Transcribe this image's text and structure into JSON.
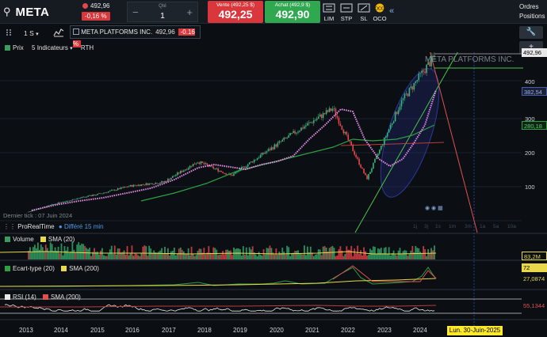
{
  "header": {
    "symbol": "META",
    "last_price": "492,96",
    "change_pct": "-0,16 %",
    "qty_label": "Qté",
    "qty_value": "1",
    "sell_label": "Vente (492,25 $)",
    "sell_price": "492,25",
    "buy_label": "Achat (492,9 $)",
    "buy_price": "492,90",
    "order_buttons": [
      "LIM",
      "STP",
      "SL",
      "OCO"
    ],
    "orders_label": "Ordres",
    "positions_label": "Positions"
  },
  "toolbar": {
    "timeframe": "1 S",
    "instrument_name": "META PLATFORMS INC.",
    "instrument_price": "492,96",
    "instrument_change": "-0.16 %"
  },
  "legend": {
    "price_label": "Prix",
    "indicators_label": "5 Indicateurs",
    "session_label": "RTH"
  },
  "chart_overlay": {
    "watermark": "META PLATFORMS INC.",
    "last_tick": "Dernier tick : 07 Juin 2024",
    "provider": "ProRealTime",
    "delay": "Différé 15 min",
    "zoom_labels": [
      "1j",
      "3j",
      "1s",
      "1m",
      "3m",
      "1a",
      "5a",
      "10a"
    ]
  },
  "price_axis": {
    "ticks": [
      "400",
      "300",
      "200",
      "100"
    ],
    "labels": {
      "last": "492,96",
      "sma_fast": "382,54",
      "sma_slow": "280,18",
      "volume": "83,2M",
      "stdev_top": "72",
      "stdev": "27,0874",
      "rsi": "55,1344"
    }
  },
  "panels": {
    "volume": {
      "name": "Volume",
      "sma": "SMA (20)"
    },
    "stdev": {
      "name": "Ecart-type (20)",
      "sma": "SMA (200)"
    },
    "rsi": {
      "name": "RSI (14)",
      "sma": "SMA (200)"
    }
  },
  "x_axis": {
    "years": [
      "2013",
      "2014",
      "2015",
      "2016",
      "2017",
      "2018",
      "2019",
      "2020",
      "2021",
      "2022",
      "2023",
      "2024"
    ],
    "cursor_date": "Lun. 30-Juin-2025"
  },
  "colors": {
    "sell": "#d9373c",
    "buy": "#2fa84f",
    "sma_fast": "#e88ce8",
    "sma_slow": "#2ea043",
    "accent_blue": "#2c5fd8"
  },
  "chart_data": {
    "type": "candlestick",
    "title": "META PLATFORMS INC.",
    "timeframe": "1 S",
    "ylim": [
      0,
      500
    ],
    "yticks": [
      100,
      200,
      300,
      400
    ],
    "x": [
      "2013",
      "2014",
      "2015",
      "2016",
      "2017",
      "2018",
      "2019",
      "2020",
      "2021",
      "2022",
      "2023",
      "2024"
    ],
    "series": [
      {
        "name": "Prix",
        "values": [
          27,
          57,
          78,
          104,
          116,
          177,
          135,
          205,
          273,
          336,
          125,
          353,
          492.96
        ]
      },
      {
        "name": "SMA",
        "values": [
          25,
          40,
          70,
          95,
          120,
          160,
          170,
          200,
          260,
          320,
          200,
          240,
          382.54
        ]
      },
      {
        "name": "SMA",
        "values": [
          20,
          35,
          55,
          75,
          95,
          120,
          145,
          175,
          210,
          250,
          265,
          275,
          280.18
        ]
      }
    ]
  }
}
